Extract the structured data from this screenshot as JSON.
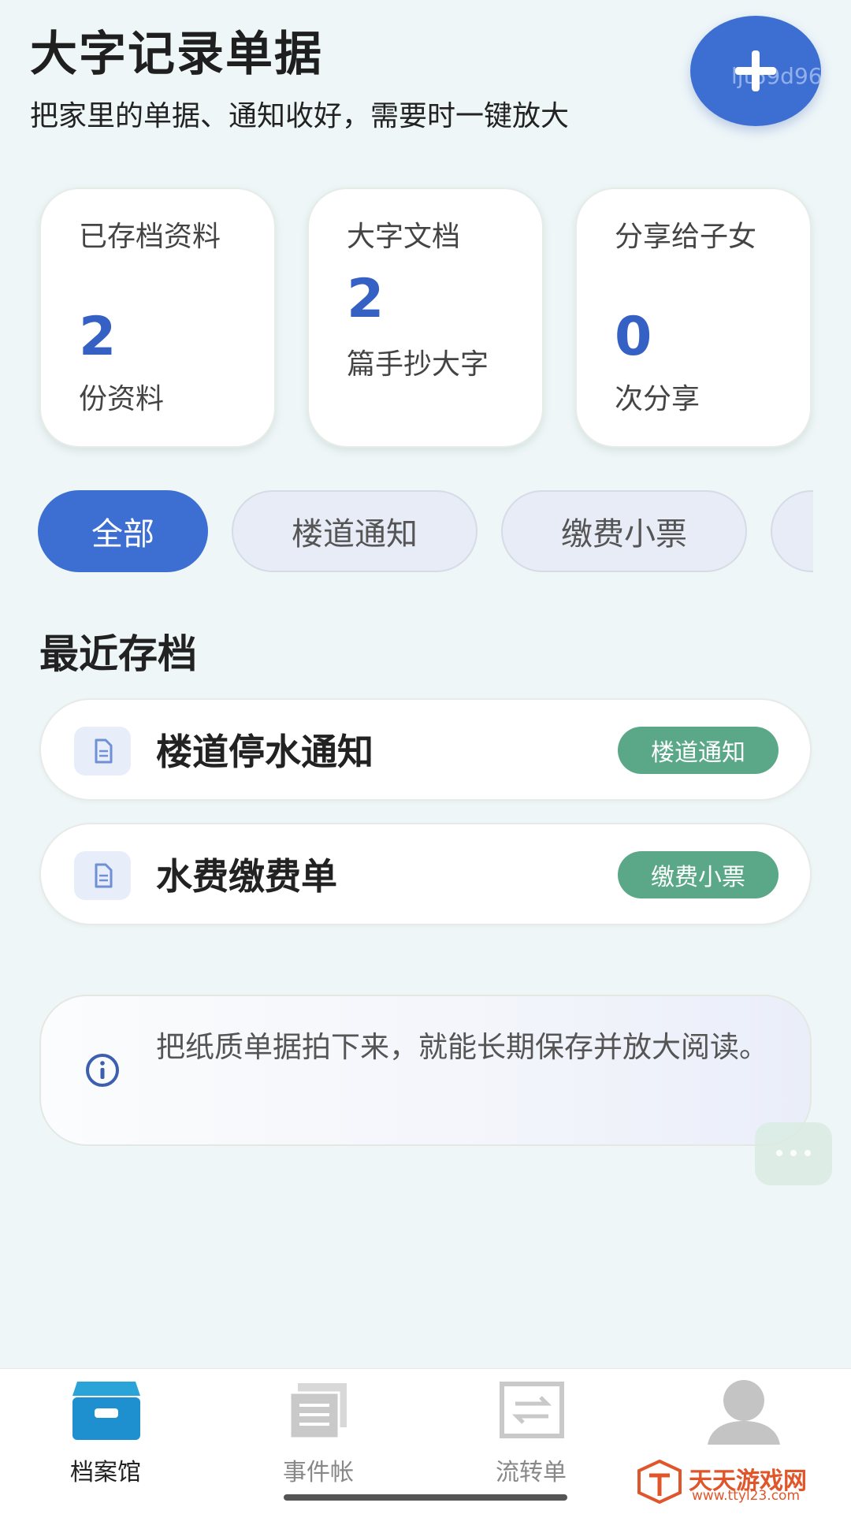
{
  "header": {
    "title": "大字记录单据",
    "subtitle": "把家里的单据、通知收好，需要时一键放大",
    "fab_watermark": "ljt69d96"
  },
  "stats": [
    {
      "label": "已存档资料",
      "value": "2",
      "unit": "份资料"
    },
    {
      "label": "大字文档",
      "value": "2",
      "unit": "篇手抄大字"
    },
    {
      "label": "分享给子女",
      "value": "0",
      "unit": "次分享"
    }
  ],
  "filters": [
    {
      "label": "全部",
      "active": true
    },
    {
      "label": "楼道通知",
      "active": false
    },
    {
      "label": "缴费小票",
      "active": false
    }
  ],
  "recent": {
    "title": "最近存档",
    "items": [
      {
        "title": "楼道停水通知",
        "tag": "楼道通知"
      },
      {
        "title": "水费缴费单",
        "tag": "缴费小票"
      }
    ]
  },
  "tip": {
    "text": "把纸质单据拍下来，就能长期保存并放大阅读。",
    "icon": "info-icon"
  },
  "nav": [
    {
      "label": "档案馆",
      "icon": "archive-box-icon",
      "active": true
    },
    {
      "label": "事件帐",
      "icon": "ledger-icon",
      "active": false
    },
    {
      "label": "流转单",
      "icon": "transfer-icon",
      "active": false
    },
    {
      "label": "",
      "icon": "profile-avatar-icon",
      "active": false
    }
  ],
  "brand": {
    "name": "天天游戏网",
    "url": "www.ttyl23.com"
  },
  "colors": {
    "primary": "#3d6fd3",
    "tag": "#5aa888",
    "background": "#eef6f8"
  }
}
